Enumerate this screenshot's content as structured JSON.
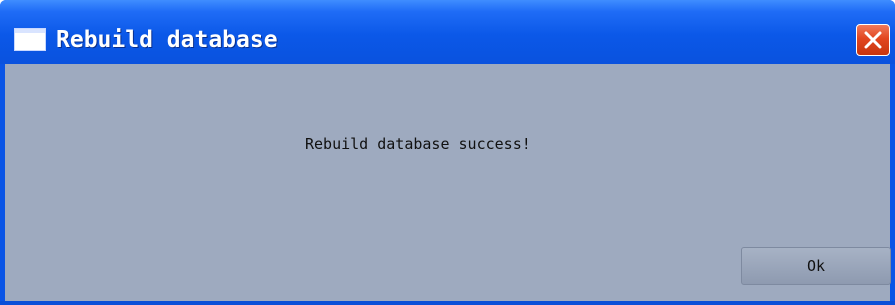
{
  "window": {
    "title": "Rebuild database",
    "titlebar_color": "#0a55e6",
    "body_color": "#9eaabf"
  },
  "icons": {
    "window_icon": "window-icon",
    "close": "close-icon"
  },
  "dialog": {
    "message": "Rebuild database success!",
    "ok_label": "Ok"
  }
}
